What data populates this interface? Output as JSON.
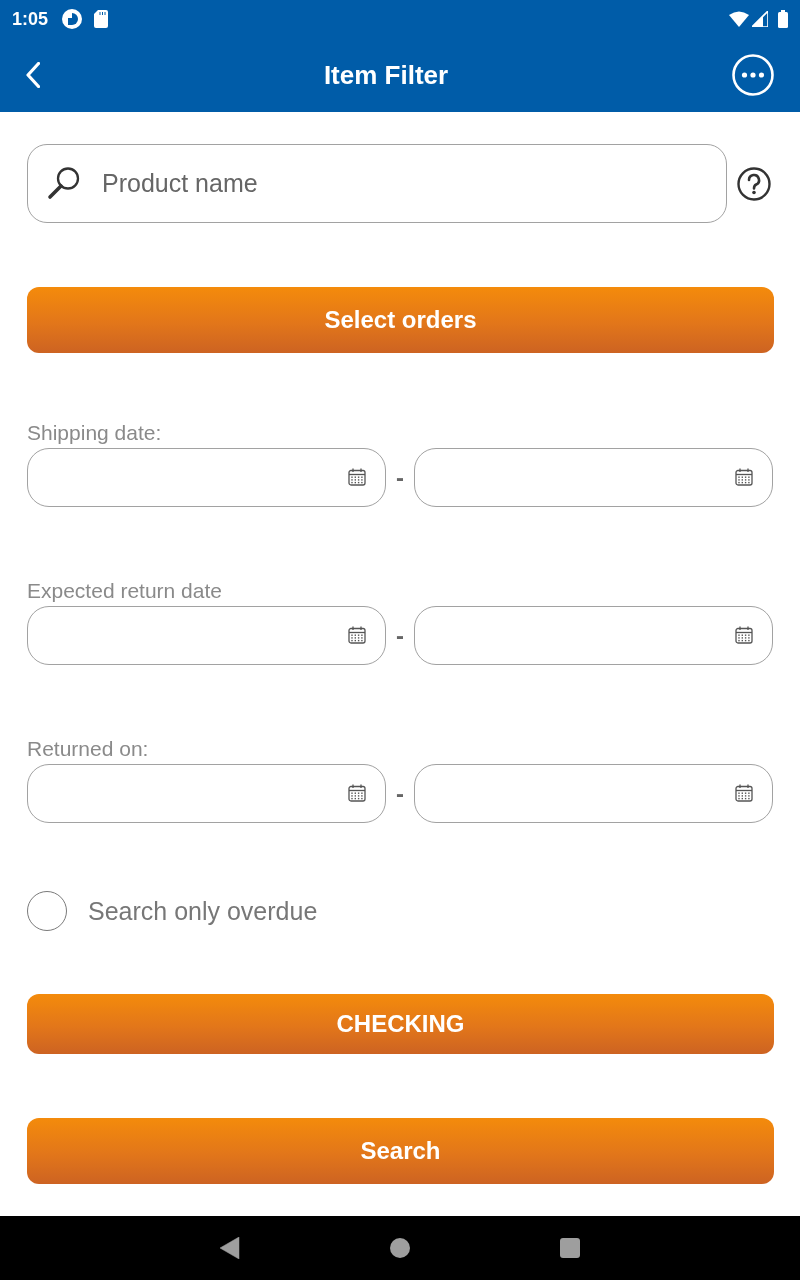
{
  "status_bar": {
    "time": "1:05"
  },
  "app_bar": {
    "title": "Item Filter"
  },
  "search": {
    "placeholder": "Product name"
  },
  "select_button": {
    "label": "Select orders"
  },
  "date_ranges": [
    {
      "label": "Shipping date:",
      "separator": "-"
    },
    {
      "label": "Expected return date",
      "separator": "-"
    },
    {
      "label": "Returned on:",
      "separator": "-"
    }
  ],
  "overdue": {
    "label": "Search only overdue",
    "checked": false
  },
  "buttons": [
    {
      "label": "CHECKING"
    },
    {
      "label": "Search"
    }
  ]
}
